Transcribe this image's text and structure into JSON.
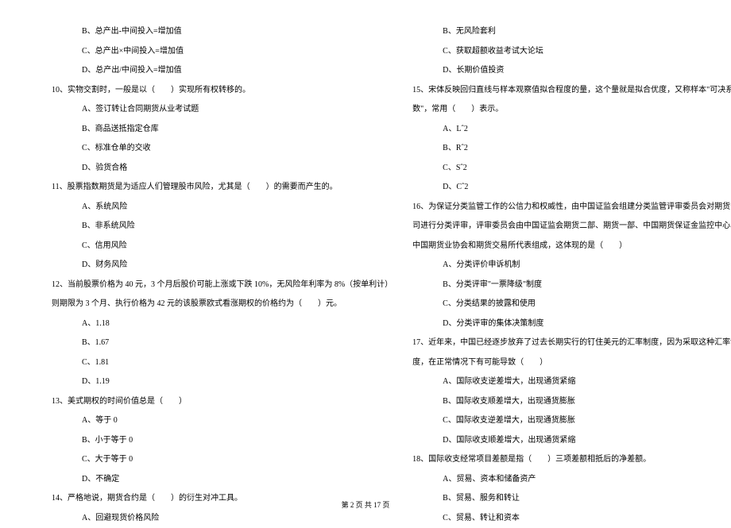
{
  "left": {
    "q9_options": [
      "B、总产出-中间投入=增加值",
      "C、总产出×中间投入=增加值",
      "D、总产出/中间投入=增加值"
    ],
    "q10": "10、实物交割时，一般是以（　　）实现所有权转移的。",
    "q10_options": [
      "A、签订转让合同期货从业考试题",
      "B、商品送抵指定仓库",
      "C、标准仓单的交收",
      "D、验货合格"
    ],
    "q11": "11、股票指数期货是为适应人们管理股市风险，尤其是（　　）的需要而产生的。",
    "q11_options": [
      "A、系统风险",
      "B、非系统风险",
      "C、信用风险",
      "D、财务风险"
    ],
    "q12": "12、当前股票价格为 40 元，3 个月后股价可能上涨或下跌 10%，无风险年利率为 8%（按单利计）",
    "q12_cont": "则期限为 3 个月、执行价格为 42 元的该股票欧式看涨期权的价格约为（　　）元。",
    "q12_options": [
      "A、1.18",
      "B、1.67",
      "C、1.81",
      "D、1.19"
    ],
    "q13": "13、美式期权的时间价值总是（　　）",
    "q13_options": [
      "A、等于 0",
      "B、小于等于 0",
      "C、大于等于 0",
      "D、不确定"
    ],
    "q14": "14、严格地说，期货合约是（　　）的衍生对冲工具。",
    "q14_options": [
      "A、回避现货价格风险"
    ]
  },
  "right": {
    "q14_options_cont": [
      "B、无风险套利",
      "C、获取超额收益考试大论坛",
      "D、长期价值投资"
    ],
    "q15": "15、宋体反映回归直线与样本观察值拟合程度的量，这个量就是拟合优度，又称样本\"可决系",
    "q15_cont": "数\"，常用（　　）表示。",
    "q15_options": [
      "A、Lˆ2",
      "B、Rˆ2",
      "C、Sˆ2",
      "D、Cˆ2"
    ],
    "q16": "16、为保证分类监管工作的公信力和权威性，由中国证监会组建分类监管评审委员会对期货公",
    "q16_cont1": "司进行分类评审，评审委员会由中国证监会期货二部、期货一部、中国期货保证金监控中心、",
    "q16_cont2": "中国期货业协会和期货交易所代表组成，这体现的是（　　）",
    "q16_options": [
      "A、分类评价申诉机制",
      "B、分类评审\"一票降级\"制度",
      "C、分类结果的披露和使用",
      "D、分类评审的集体决策制度"
    ],
    "q17": "17、近年来，中国已经逐步放弃了过去长期实行的钉住美元的汇率制度，因为采取这种汇率制",
    "q17_cont": "度，在正常情况下有可能导致（　　）",
    "q17_options": [
      "A、国际收支逆差增大，出现通货紧缩",
      "B、国际收支顺差增大，出现通货膨胀",
      "C、国际收支逆差增大，出现通货膨胀",
      "D、国际收支顺差增大，出现通货紧缩"
    ],
    "q18": "18、国际收支经常项目差额是指（　　）三项差额相抵后的净差额。",
    "q18_options": [
      "A、贸易、资本和储备资产",
      "B、贸易、服务和转让",
      "C、贸易、转让和资本"
    ]
  },
  "footer": "第 2 页 共 17 页"
}
